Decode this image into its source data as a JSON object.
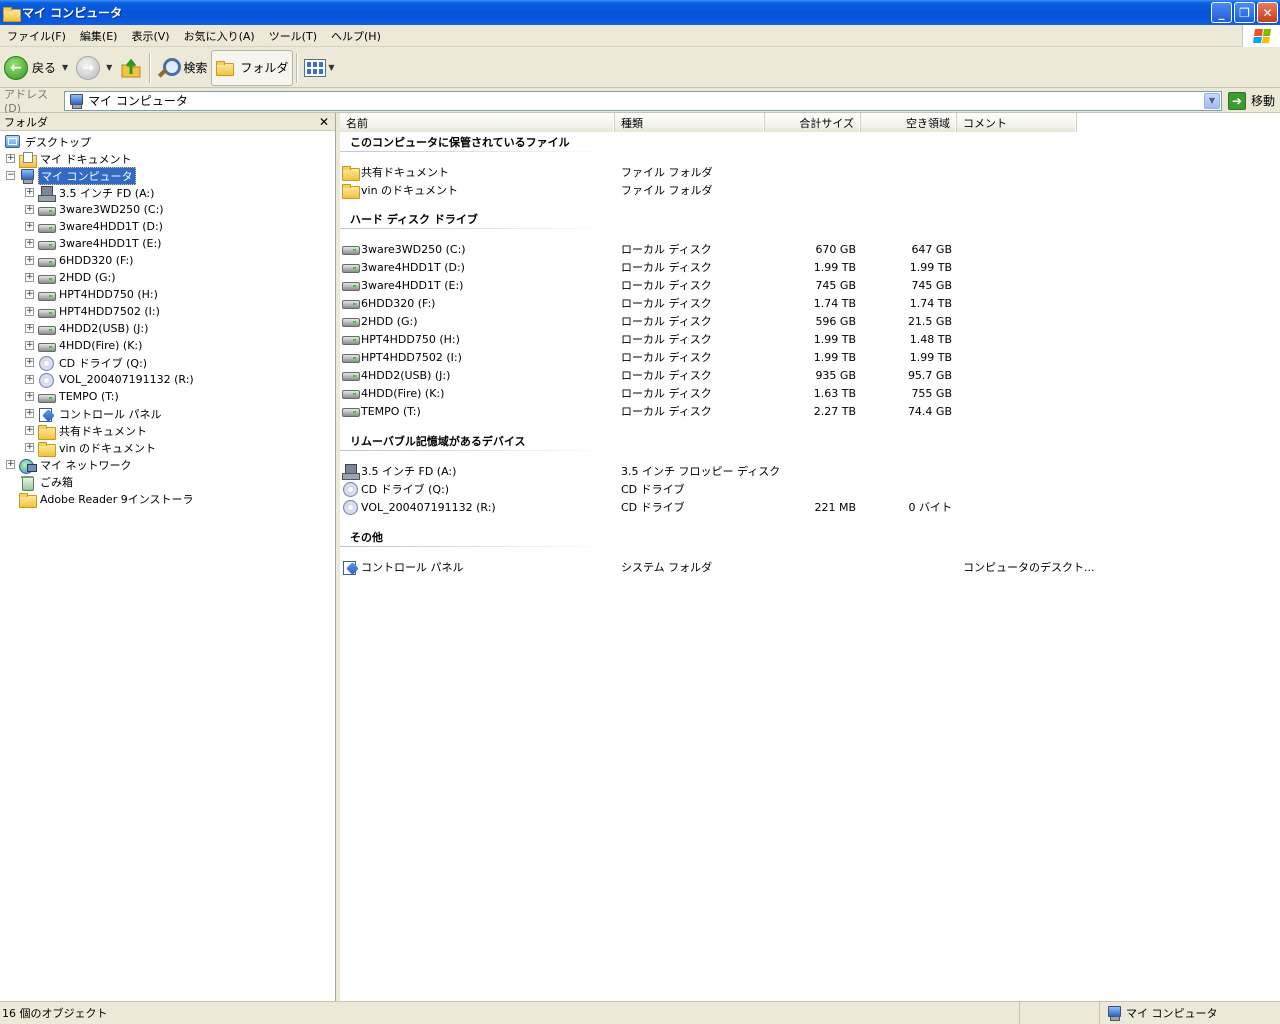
{
  "window": {
    "title": "マイ コンピュータ"
  },
  "menu": [
    "ファイル(F)",
    "編集(E)",
    "表示(V)",
    "お気に入り(A)",
    "ツール(T)",
    "ヘルプ(H)"
  ],
  "toolbar": {
    "back": "戻る",
    "search": "検索",
    "folders": "フォルダ"
  },
  "address": {
    "label": "アドレス(D)",
    "value": "マイ コンピュータ",
    "go": "移動"
  },
  "folder_pane": {
    "title": "フォルダ",
    "items": [
      {
        "label": "デスクトップ",
        "icon": "desktop-icon",
        "level": 0,
        "expander": ""
      },
      {
        "label": "マイ ドキュメント",
        "icon": "my-documents-icon",
        "level": 1,
        "expander": "+"
      },
      {
        "label": "マイ コンピュータ",
        "icon": "computer-icon",
        "level": 1,
        "expander": "−",
        "selected": true
      },
      {
        "label": "3.5 インチ FD (A:)",
        "icon": "floppy-icon",
        "level": 2,
        "expander": "+"
      },
      {
        "label": "3ware3WD250 (C:)",
        "icon": "drive-icon",
        "level": 2,
        "expander": "+"
      },
      {
        "label": "3ware4HDD1T (D:)",
        "icon": "drive-icon",
        "level": 2,
        "expander": "+"
      },
      {
        "label": "3ware4HDD1T (E:)",
        "icon": "drive-icon",
        "level": 2,
        "expander": "+"
      },
      {
        "label": "6HDD320 (F:)",
        "icon": "drive-icon",
        "level": 2,
        "expander": "+"
      },
      {
        "label": "2HDD (G:)",
        "icon": "drive-icon",
        "level": 2,
        "expander": "+"
      },
      {
        "label": "HPT4HDD750 (H:)",
        "icon": "drive-icon",
        "level": 2,
        "expander": "+"
      },
      {
        "label": "HPT4HDD7502 (I:)",
        "icon": "drive-icon",
        "level": 2,
        "expander": "+"
      },
      {
        "label": "4HDD2(USB) (J:)",
        "icon": "drive-icon",
        "level": 2,
        "expander": "+"
      },
      {
        "label": "4HDD(Fire) (K:)",
        "icon": "drive-icon",
        "level": 2,
        "expander": "+"
      },
      {
        "label": "CD ドライブ (Q:)",
        "icon": "cd-icon",
        "level": 2,
        "expander": "+"
      },
      {
        "label": "VOL_200407191132 (R:)",
        "icon": "cd-icon",
        "level": 2,
        "expander": "+"
      },
      {
        "label": "TEMPO (T:)",
        "icon": "drive-icon",
        "level": 2,
        "expander": "+"
      },
      {
        "label": "コントロール パネル",
        "icon": "control-panel-icon",
        "level": 2,
        "expander": "+"
      },
      {
        "label": "共有ドキュメント",
        "icon": "folder-icon",
        "level": 2,
        "expander": "+"
      },
      {
        "label": "vin のドキュメント",
        "icon": "folder-icon",
        "level": 2,
        "expander": "+"
      },
      {
        "label": "マイ ネットワーク",
        "icon": "network-icon",
        "level": 1,
        "expander": "+"
      },
      {
        "label": "ごみ箱",
        "icon": "recycle-bin-icon",
        "level": 1,
        "expander": ""
      },
      {
        "label": "Adobe Reader 9インストーラ",
        "icon": "folder-icon",
        "level": 1,
        "expander": ""
      }
    ]
  },
  "columns": [
    "名前",
    "種類",
    "合計サイズ",
    "空き領域",
    "コメント"
  ],
  "groups": [
    {
      "title": "このコンピュータに保管されているファイル",
      "items": [
        {
          "name": "共有ドキュメント",
          "icon": "folder-icon",
          "type": "ファイル フォルダ",
          "size": "",
          "free": "",
          "comment": ""
        },
        {
          "name": "vin のドキュメント",
          "icon": "folder-icon",
          "type": "ファイル フォルダ",
          "size": "",
          "free": "",
          "comment": ""
        }
      ]
    },
    {
      "title": "ハード ディスク ドライブ",
      "items": [
        {
          "name": "3ware3WD250 (C:)",
          "icon": "drive-icon",
          "type": "ローカル ディスク",
          "size": "670 GB",
          "free": "647 GB",
          "comment": ""
        },
        {
          "name": "3ware4HDD1T (D:)",
          "icon": "drive-icon",
          "type": "ローカル ディスク",
          "size": "1.99 TB",
          "free": "1.99 TB",
          "comment": ""
        },
        {
          "name": "3ware4HDD1T (E:)",
          "icon": "drive-icon",
          "type": "ローカル ディスク",
          "size": "745 GB",
          "free": "745 GB",
          "comment": ""
        },
        {
          "name": "6HDD320 (F:)",
          "icon": "drive-icon",
          "type": "ローカル ディスク",
          "size": "1.74 TB",
          "free": "1.74 TB",
          "comment": ""
        },
        {
          "name": "2HDD (G:)",
          "icon": "drive-icon",
          "type": "ローカル ディスク",
          "size": "596 GB",
          "free": "21.5 GB",
          "comment": ""
        },
        {
          "name": "HPT4HDD750 (H:)",
          "icon": "drive-icon",
          "type": "ローカル ディスク",
          "size": "1.99 TB",
          "free": "1.48 TB",
          "comment": ""
        },
        {
          "name": "HPT4HDD7502 (I:)",
          "icon": "drive-icon",
          "type": "ローカル ディスク",
          "size": "1.99 TB",
          "free": "1.99 TB",
          "comment": ""
        },
        {
          "name": "4HDD2(USB) (J:)",
          "icon": "drive-icon",
          "type": "ローカル ディスク",
          "size": "935 GB",
          "free": "95.7 GB",
          "comment": ""
        },
        {
          "name": "4HDD(Fire) (K:)",
          "icon": "drive-icon",
          "type": "ローカル ディスク",
          "size": "1.63 TB",
          "free": "755 GB",
          "comment": ""
        },
        {
          "name": "TEMPO (T:)",
          "icon": "drive-icon",
          "type": "ローカル ディスク",
          "size": "2.27 TB",
          "free": "74.4 GB",
          "comment": ""
        }
      ]
    },
    {
      "title": "リムーバブル記憶域があるデバイス",
      "items": [
        {
          "name": "3.5 インチ FD (A:)",
          "icon": "floppy-icon",
          "type": "3.5 インチ フロッピー ディスク",
          "size": "",
          "free": "",
          "comment": ""
        },
        {
          "name": "CD ドライブ (Q:)",
          "icon": "cd-icon",
          "type": "CD ドライブ",
          "size": "",
          "free": "",
          "comment": ""
        },
        {
          "name": "VOL_200407191132 (R:)",
          "icon": "cd-icon",
          "type": "CD ドライブ",
          "size": "221 MB",
          "free": "0 バイト",
          "comment": ""
        }
      ]
    },
    {
      "title": "その他",
      "items": [
        {
          "name": "コントロール パネル",
          "icon": "control-panel-icon",
          "type": "システム フォルダ",
          "size": "",
          "free": "",
          "comment": "コンピュータのデスクト..."
        }
      ]
    }
  ],
  "status": {
    "count": "16 個のオブジェクト",
    "location": "マイ コンピュータ"
  }
}
